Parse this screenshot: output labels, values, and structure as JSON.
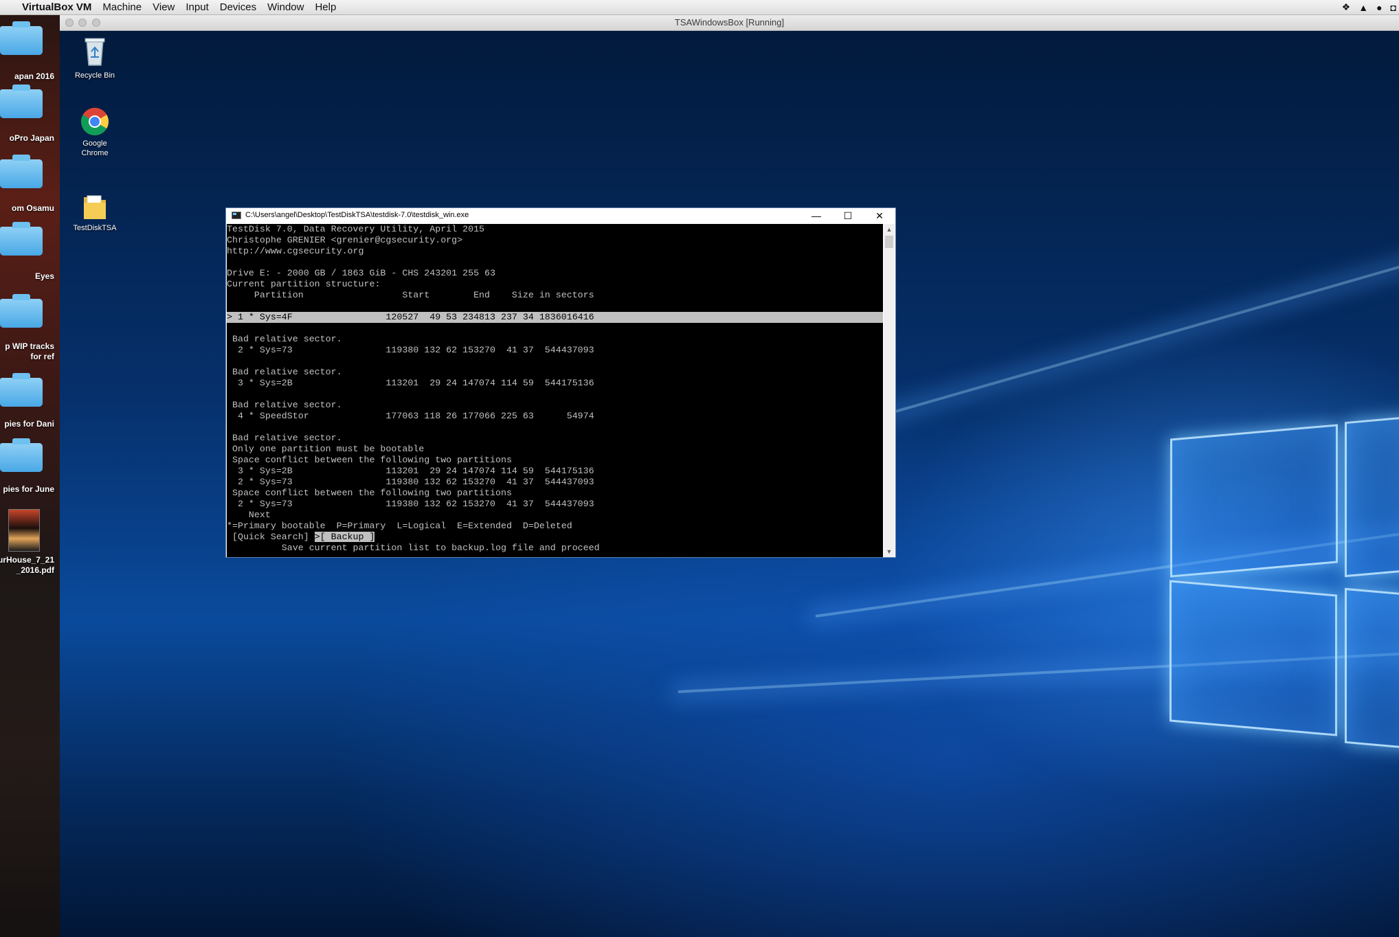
{
  "menubar": {
    "app_name": "VirtualBox VM",
    "items": [
      "Machine",
      "View",
      "Input",
      "Devices",
      "Window",
      "Help"
    ]
  },
  "mac_desktop": {
    "items": [
      {
        "label": "apan 2016",
        "kind": "folder"
      },
      {
        "label": "oPro Japan",
        "kind": "folder"
      },
      {
        "label": "om Osamu",
        "kind": "folder"
      },
      {
        "label": "Eyes",
        "kind": "folder"
      },
      {
        "label": "p WIP tracks\nfor ref",
        "kind": "folder"
      },
      {
        "label": "pies for Dani",
        "kind": "folder"
      },
      {
        "label": "pies for June",
        "kind": "folder"
      },
      {
        "label": "urHouse_7_21\n_2016.pdf",
        "kind": "pdf"
      }
    ]
  },
  "vm": {
    "title": "TSAWindowsBox [Running]"
  },
  "win_desktop": {
    "icons": [
      {
        "label": "Recycle Bin",
        "icon": "recycle-bin-icon"
      },
      {
        "label": "Google\nChrome",
        "icon": "chrome-icon"
      },
      {
        "label": "TestDiskTSA",
        "icon": "folder-icon"
      }
    ]
  },
  "console": {
    "title": "C:\\Users\\angel\\Desktop\\TestDiskTSA\\testdisk-7.0\\testdisk_win.exe",
    "minimize": "—",
    "maximize": "☐",
    "close": "✕",
    "lines": [
      "TestDisk 7.0, Data Recovery Utility, April 2015",
      "Christophe GRENIER <grenier@cgsecurity.org>",
      "http://www.cgsecurity.org",
      "",
      "Drive E: - 2000 GB / 1863 GiB - CHS 243201 255 63",
      "Current partition structure:",
      "     Partition                  Start        End    Size in sectors",
      "",
      "> 1 * Sys=4F                 120527  49 53 234813 237 34 1836016416",
      "",
      " Bad relative sector.",
      "  2 * Sys=73                 119380 132 62 153270  41 37  544437093",
      "",
      " Bad relative sector.",
      "  3 * Sys=2B                 113201  29 24 147074 114 59  544175136",
      "",
      " Bad relative sector.",
      "  4 * SpeedStor              177063 118 26 177066 225 63      54974",
      "",
      " Bad relative sector.",
      " Only one partition must be bootable",
      " Space conflict between the following two partitions",
      "  3 * Sys=2B                 113201  29 24 147074 114 59  544175136",
      "  2 * Sys=73                 119380 132 62 153270  41 37  544437093",
      " Space conflict between the following two partitions",
      "  2 * Sys=73                 119380 132 62 153270  41 37  544437093",
      "    Next",
      "*=Primary bootable  P=Primary  L=Logical  E=Extended  D=Deleted"
    ],
    "highlight_line": 8,
    "menu_quick_search": " [Quick Search] ",
    "menu_backup": ">[ Backup ]",
    "help_line": "          Save current partition list to backup.log file and proceed"
  }
}
